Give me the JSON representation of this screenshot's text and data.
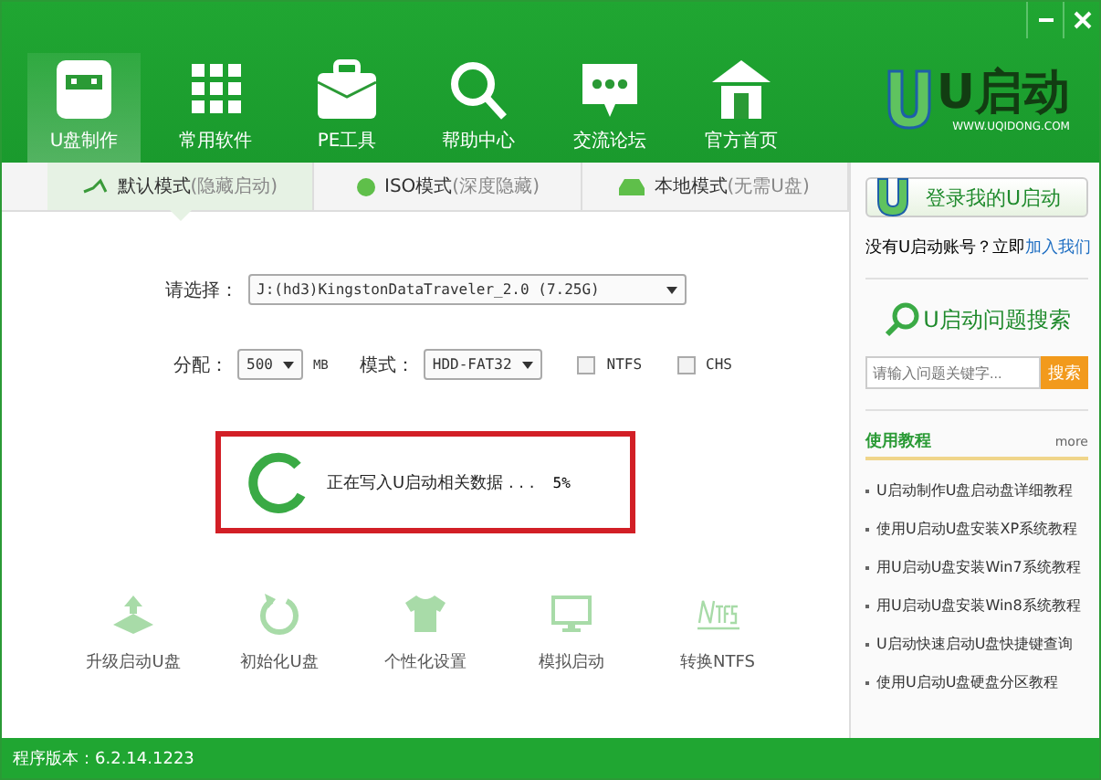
{
  "window": {
    "controls": [
      {
        "kind": "minimize"
      },
      {
        "kind": "close"
      }
    ]
  },
  "nav": [
    {
      "label": "U盘制作",
      "kind": "usb",
      "selected": true
    },
    {
      "label": "常用软件",
      "kind": "grid",
      "selected": false
    },
    {
      "label": "PE工具",
      "kind": "briefcase",
      "selected": false
    },
    {
      "label": "帮助中心",
      "kind": "search",
      "selected": false
    },
    {
      "label": "交流论坛",
      "kind": "chat",
      "selected": false
    },
    {
      "label": "官方首页",
      "kind": "home",
      "selected": false
    }
  ],
  "logo": {
    "name": "U启动",
    "url": "WWW.UQIDONG.COM"
  },
  "tabs": [
    {
      "label": "默认模式",
      "note": "(隐藏启动)",
      "kind": "nodes",
      "selected": true
    },
    {
      "label": "ISO模式",
      "note": "(深度隐藏)",
      "kind": "dot",
      "selected": false
    },
    {
      "label": "本地模式",
      "note": "(无需U盘)",
      "kind": "drive",
      "selected": false
    }
  ],
  "form": {
    "drive_label": "请选择：",
    "drive": "J:(hd3)KingstonDataTraveler_2.0 (7.25G)",
    "alloc_label": "分配：",
    "alloc": "500",
    "unit": "MB",
    "mode_label": "模式：",
    "mode": "HDD-FAT32",
    "options": [
      {
        "label": "NTFS",
        "checked": false
      },
      {
        "label": "CHS",
        "checked": false
      }
    ]
  },
  "progress": {
    "message": "正在写入U启动相关数据 . . .",
    "percent": "5%",
    "highlighted": true
  },
  "tools": [
    {
      "label": "升级启动U盘",
      "kind": "upgrade"
    },
    {
      "label": "初始化U盘",
      "kind": "reset"
    },
    {
      "label": "个性化设置",
      "kind": "shirt"
    },
    {
      "label": "模拟启动",
      "kind": "monitor"
    },
    {
      "label": "转换NTFS",
      "kind": "ntfs"
    }
  ],
  "status_bar": "程序版本：6.2.14.1223",
  "sidebar": {
    "login": "登录我的U启动",
    "prompt": "没有U启动账号？立即",
    "join": "加入我们",
    "search_title": "U启动问题搜索",
    "search": {
      "placeholder": "请输入问题关键字..."
    },
    "search_button": "搜索",
    "section": "使用教程",
    "more": "more",
    "tutorials": [
      "U启动制作U盘启动盘详细教程",
      "使用U启动U盘安装XP系统教程",
      "用U启动U盘安装Win7系统教程",
      "用U启动U盘安装Win8系统教程",
      "U启动快速启动U盘快捷键查询",
      "使用U启动U盘硬盘分区教程"
    ]
  }
}
